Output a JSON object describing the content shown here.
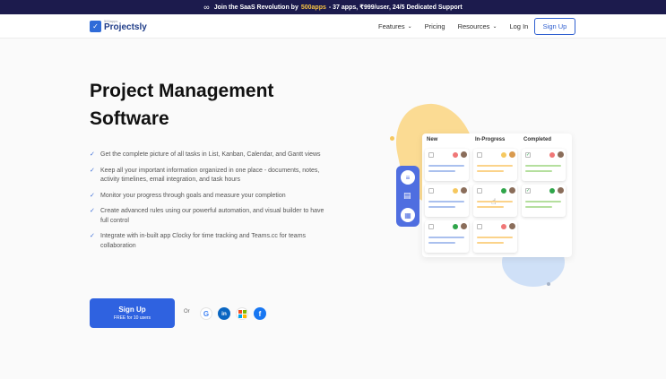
{
  "banner": {
    "icon": "infinity-icon",
    "pre": "Join the SaaS Revolution by",
    "highlight": "500apps",
    "post": "- 37 apps, ₹999/user, 24/5 Dedicated Support"
  },
  "nav": {
    "logo_small": "500apps",
    "logo_name": "Projectsly",
    "features": "Features",
    "pricing": "Pricing",
    "resources": "Resources",
    "login": "Log In",
    "signup": "Sign Up"
  },
  "hero": {
    "title_line1": "Project Management",
    "title_line2": "Software"
  },
  "features": [
    "Get the complete picture of all tasks in List, Kanban, Calendar, and Gantt views",
    "Keep all your important information organized in one place - documents, notes, activity timelines, email integration, and task hours",
    "Monitor your progress through goals and measure your completion",
    "Create advanced rules using our powerful automation, and visual builder to have full control",
    "Integrate with in-built app Clocky for time tracking and Teams.cc for teams collaboration"
  ],
  "cta": {
    "label": "Sign Up",
    "sub": "FREE for 10 users",
    "or": "Or"
  },
  "board": {
    "columns": [
      "New",
      "In-Progress",
      "Completed"
    ]
  },
  "colors": {
    "primary": "#2f62e0",
    "banner_bg": "#1c1b4d",
    "highlight": "#f6c343"
  }
}
